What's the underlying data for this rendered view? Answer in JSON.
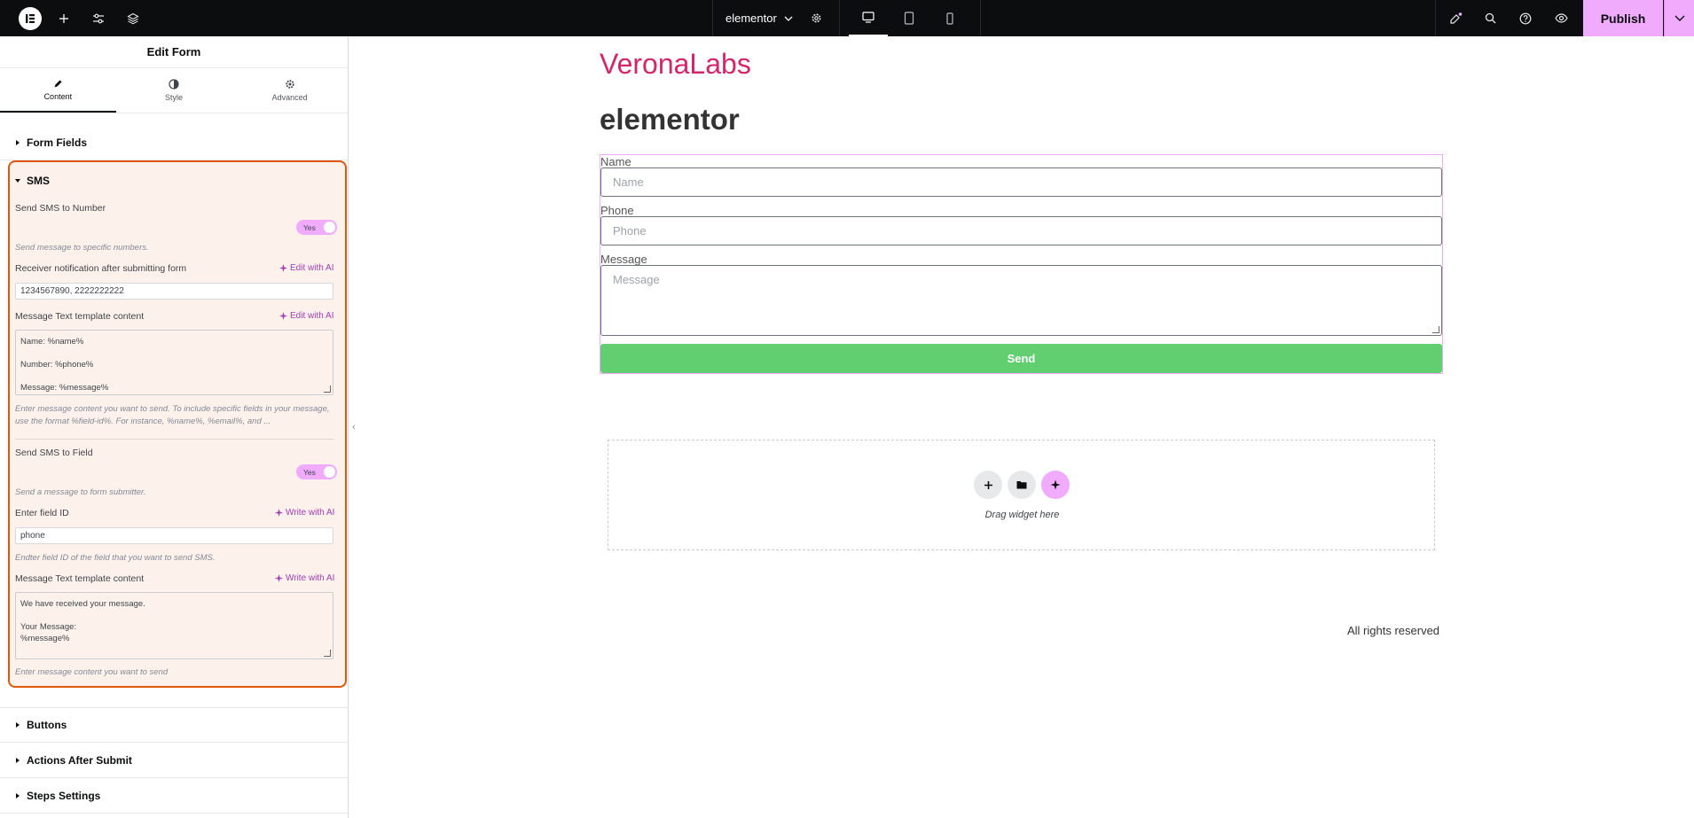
{
  "topbar": {
    "doc_title": "elementor",
    "publish_label": "Publish",
    "icons": [
      "elementor-logo-icon",
      "add-icon",
      "settings-sliders-icon",
      "layers-icon",
      "chevron-down-icon",
      "gear-icon",
      "desktop-icon",
      "tablet-icon",
      "mobile-icon",
      "whats-new-icon",
      "search-icon",
      "help-icon",
      "preview-eye-icon"
    ]
  },
  "panel": {
    "title": "Edit Form",
    "tabs": [
      {
        "label": "Content",
        "active": true
      },
      {
        "label": "Style",
        "active": false
      },
      {
        "label": "Advanced",
        "active": false
      }
    ],
    "sections": {
      "form_fields": "Form Fields",
      "sms": "SMS",
      "buttons": "Buttons",
      "actions_after_submit": "Actions After Submit",
      "steps_settings": "Steps Settings"
    },
    "sms": {
      "send_to_number_label": "Send SMS to Number",
      "send_to_number_toggle": "Yes",
      "send_to_number_desc": "Send message to specific numbers.",
      "receiver_label": "Receiver notification after submitting form",
      "edit_ai_label": "Edit with AI",
      "receiver_value": "1234567890, 2222222222",
      "template_label": "Message Text template content",
      "template_line1": "Name: %name%",
      "template_line2": "Number: %phone%",
      "template_line3": "Message: %message%",
      "template_desc": "Enter message content you want to send. To include specific fields in your message, use the format %field-id%. For instance, %name%, %email%, and ...",
      "send_to_field_label": "Send SMS to Field",
      "send_to_field_toggle": "Yes",
      "send_to_field_desc": "Send a message to form submitter.",
      "field_id_label": "Enter field ID",
      "write_ai_label": "Write with AI",
      "field_id_value": "phone",
      "field_id_desc": "Endter field ID of the field that you want to send SMS.",
      "template2_label": "Message Text template content",
      "template2_line1": "We have received your message.",
      "template2_line2": "Your Message:",
      "template2_line3": "%message%",
      "template2_desc": "Enter message content you want to send"
    }
  },
  "canvas": {
    "brand": "VeronaLabs",
    "site_title": "elementor",
    "form": {
      "name_label": "Name",
      "name_placeholder": "Name",
      "phone_label": "Phone",
      "phone_placeholder": "Phone",
      "message_label": "Message",
      "message_placeholder": "Message",
      "send_label": "Send"
    },
    "drop_zone_text": "Drag widget here",
    "footer": "All rights reserved"
  },
  "colors": {
    "accent": "#f0abfc",
    "brand": "#d5266c",
    "send_button": "#61ce70",
    "highlight_border": "#e0560a",
    "topbar": "#0c0d0e"
  }
}
